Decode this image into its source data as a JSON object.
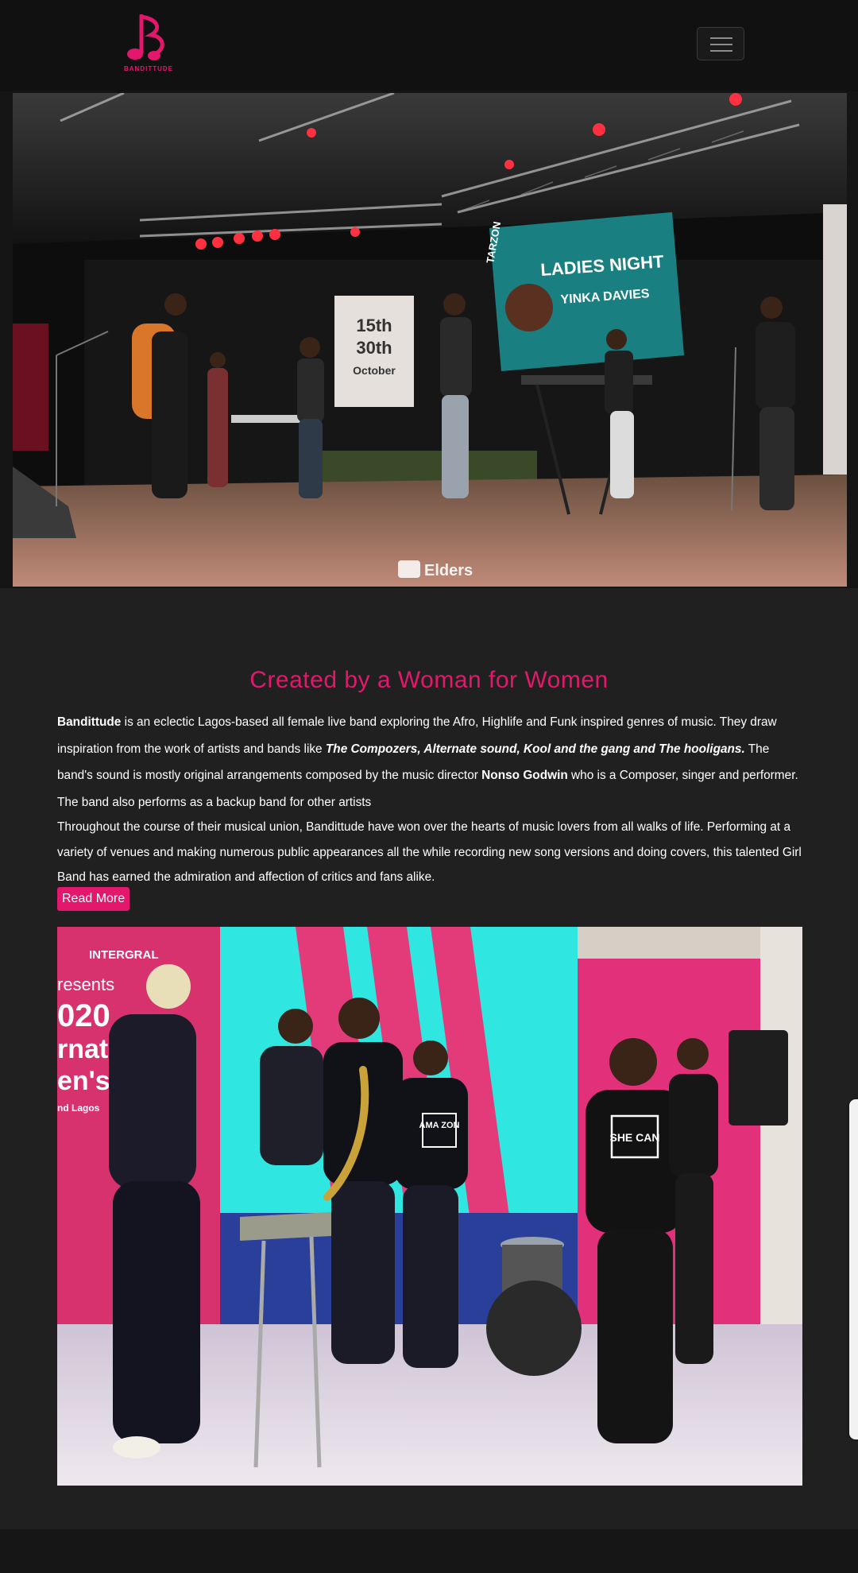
{
  "header": {
    "logo_text": "BANDITTUDE"
  },
  "about": {
    "title": "Created by a Woman for Women",
    "p1_bold": "Bandittude",
    "p1_a": " is an eclectic Lagos-based all female live band exploring the Afro, Highlife and Funk inspired genres of music. They draw inspiration from the work of artists and bands like ",
    "p1_bold_italic": "The Compozers, Alternate sound, Kool and the gang and The hooligans.",
    "p1_b": " The band's sound is mostly original arrangements composed by the music director ",
    "p1_bold2": "Nonso Godwin",
    "p1_c": " who is a Composer, singer and performer. The band also performs as a backup band for other artists",
    "p2": "Throughout the course of their musical union, Bandittude have won over the hearts of music lovers from all walks of life. Performing at a variety of venues and making numerous public appearances all the while recording new song versions and doing covers, this talented Girl Band has earned the admiration and affection of critics and fans alike.",
    "read_more": "Read More"
  },
  "hero_photo": {
    "banner_title": "LADIES NIGHT",
    "banner_name": "YINKA DAVIES",
    "banner_brand": "TARZON",
    "sign_text": [
      "15th",
      "30th",
      "October"
    ],
    "watermark": "Elders"
  },
  "band_photo": {
    "shirt_text": [
      "SHE CAN",
      "AMA ZON"
    ],
    "backdrop_text": [
      "INTERGRAL",
      "resents",
      "020",
      "rnation",
      "en's",
      "nd Lagos"
    ]
  },
  "colors": {
    "accent": "#e3186c",
    "background": "#202020",
    "navbar": "#111111"
  },
  "icons": {
    "logo": "music-note-b-logo",
    "menu": "hamburger-icon"
  }
}
